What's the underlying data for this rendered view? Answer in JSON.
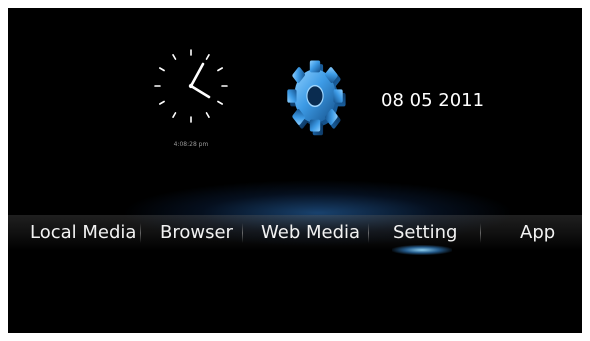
{
  "clock": {
    "icon": "analog-clock-icon",
    "time_text": "4:08:28 pm"
  },
  "settings_icon": "gear-icon",
  "date": "08 05 2011",
  "menu": {
    "items": [
      {
        "label": "Local Media"
      },
      {
        "label": "Browser"
      },
      {
        "label": "Web Media"
      },
      {
        "label": "Setting",
        "selected": true
      },
      {
        "label": "App"
      }
    ]
  },
  "colors": {
    "background": "#000000",
    "accent": "#3d9be6",
    "text": "#f2f2f2"
  }
}
